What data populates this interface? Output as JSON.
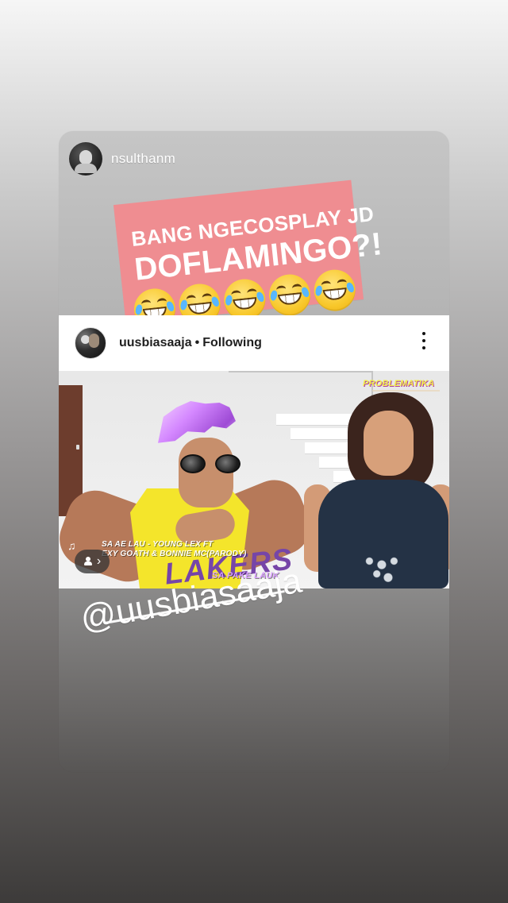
{
  "story": {
    "username": "nsulthanm"
  },
  "caption": {
    "line1": "BANG NGECOSPLAY JD",
    "line2": "DOFLAMINGO?!"
  },
  "post": {
    "username": "uusbiasaaja",
    "separator": "•",
    "following_label": "Following",
    "brand": "PROBLEMATIKA",
    "song_line1": "SA AE LAU - YOUNG LEX FT",
    "song_line2": "EXY GOATH & BONNIE MC(PARODY)",
    "song_line3": "SA PAKE LAUK",
    "jersey_text": "LAKERS"
  },
  "mention": {
    "text": "@uusbiasaaja"
  },
  "icons": {
    "story_avatar": "profile-avatar-icon",
    "post_avatar": "post-avatar-icon",
    "more": "more-vertical-icon",
    "music": "music-note-icon",
    "user": "user-icon",
    "chevron": "chevron-right-icon",
    "emoji": "laughing-emoji-icon"
  }
}
